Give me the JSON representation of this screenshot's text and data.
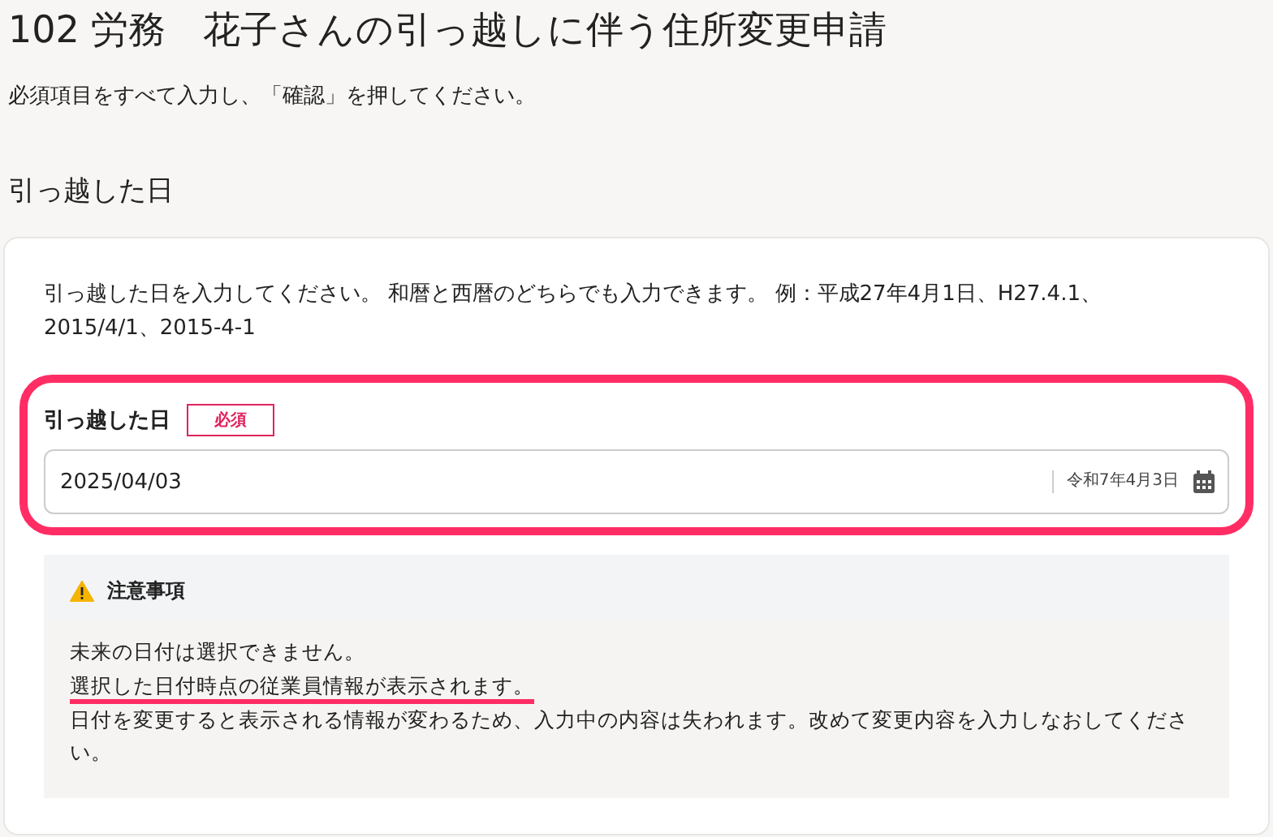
{
  "page": {
    "title": "102 労務　花子さんの引っ越しに伴う住所変更申請",
    "instruction": "必須項目をすべて入力し、「確認」を押してください。"
  },
  "section": {
    "heading": "引っ越した日",
    "description": "引っ越した日を入力してください。 和暦と西暦のどちらでも入力できます。 例：平成27年4月1日、H27.4.1、2015/4/1、2015-4-1",
    "field": {
      "label": "引っ越した日",
      "required_badge": "必須",
      "highlighted": true,
      "value": "2025/04/03",
      "era_date": "令和7年4月3日"
    },
    "notice": {
      "title": "注意事項",
      "lines": [
        {
          "text": "未来の日付は選択できません。",
          "underlined": false
        },
        {
          "text": "選択した日付時点の従業員情報が表示されます。",
          "underlined": true
        },
        {
          "text": "日付を変更すると表示される情報が変わるため、入力中の内容は失われます。改めて変更内容を入力しなおしてください。",
          "underlined": false
        }
      ]
    }
  }
}
